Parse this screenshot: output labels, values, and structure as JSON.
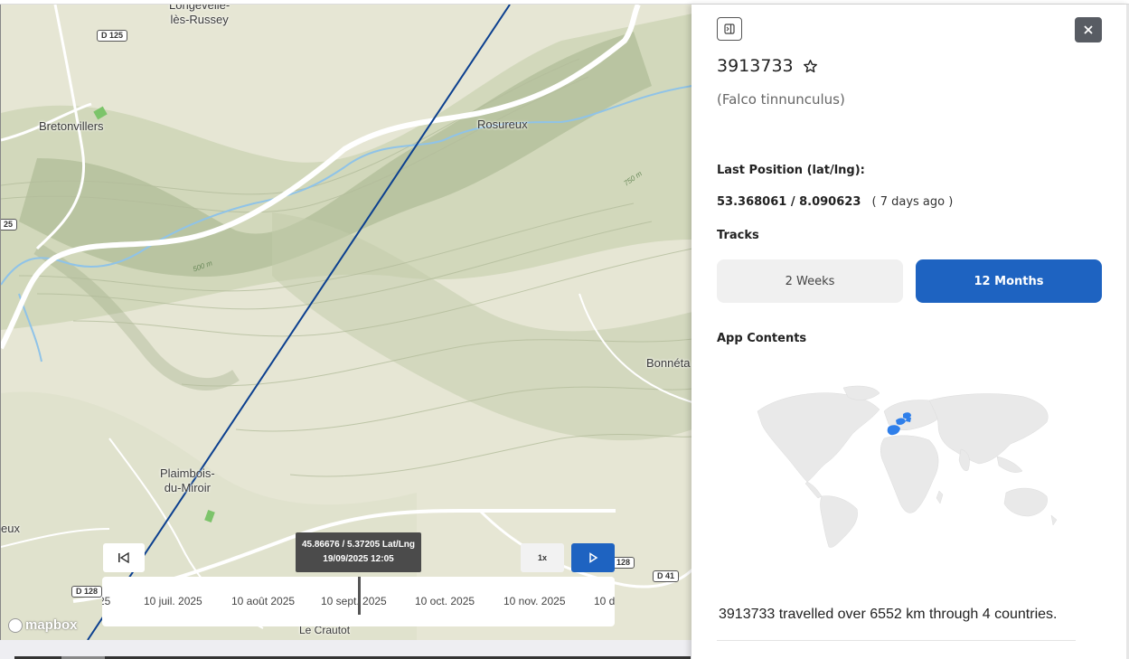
{
  "map": {
    "places": [
      {
        "id": "longevelle",
        "text": "Longevelle-\nlès-Russey"
      },
      {
        "id": "bretonvillers",
        "text": "Bretonvillers"
      },
      {
        "id": "rosureux",
        "text": "Rosureux"
      },
      {
        "id": "bonneta",
        "text": "Bonnéta"
      },
      {
        "id": "plaimbois",
        "text": "Plaimbois-\ndu-Miroir"
      },
      {
        "id": "eux",
        "text": "eux"
      },
      {
        "id": "crautot",
        "text": "Le Crautot"
      }
    ],
    "roads": [
      "D 125",
      "25",
      "D 128",
      "D 41",
      "128"
    ],
    "contours": [
      "500 m",
      "750 m"
    ],
    "attribution": "mapbox",
    "track_color": "#0b3f8f"
  },
  "controls": {
    "back_icon": "skip-back-icon",
    "speed_label": "1x",
    "play_icon": "play-icon",
    "accent": "#1e63c1"
  },
  "tooltip": {
    "coords": "45.86676 / 5.37205 Lat/Lng",
    "datetime": "19/09/2025 12:05"
  },
  "timeline": {
    "ticks": [
      "25",
      "10 juil. 2025",
      "10 août 2025",
      "10 sept. 2025",
      "10 oct. 2025",
      "10 nov. 2025",
      "10 d"
    ]
  },
  "panel": {
    "collapse_icon": "sidebar-collapse-icon",
    "close_icon": "close-icon",
    "animal_id": "3913733",
    "star_icon": "star-icon",
    "species": "(Falco tinnunculus)",
    "last_position_label": "Last Position (lat/lng):",
    "last_position_value": "53.368061 / 8.090623",
    "last_position_ago": "( 7 days ago )",
    "tracks_label": "Tracks",
    "tracks": [
      {
        "label": "2 Weeks",
        "active": false
      },
      {
        "label": "12 Months",
        "active": true
      }
    ],
    "app_contents_label": "App Contents",
    "highlight_color": "#2f7fea",
    "summary": "3913733 travelled over 6552 km through 4 countries."
  }
}
